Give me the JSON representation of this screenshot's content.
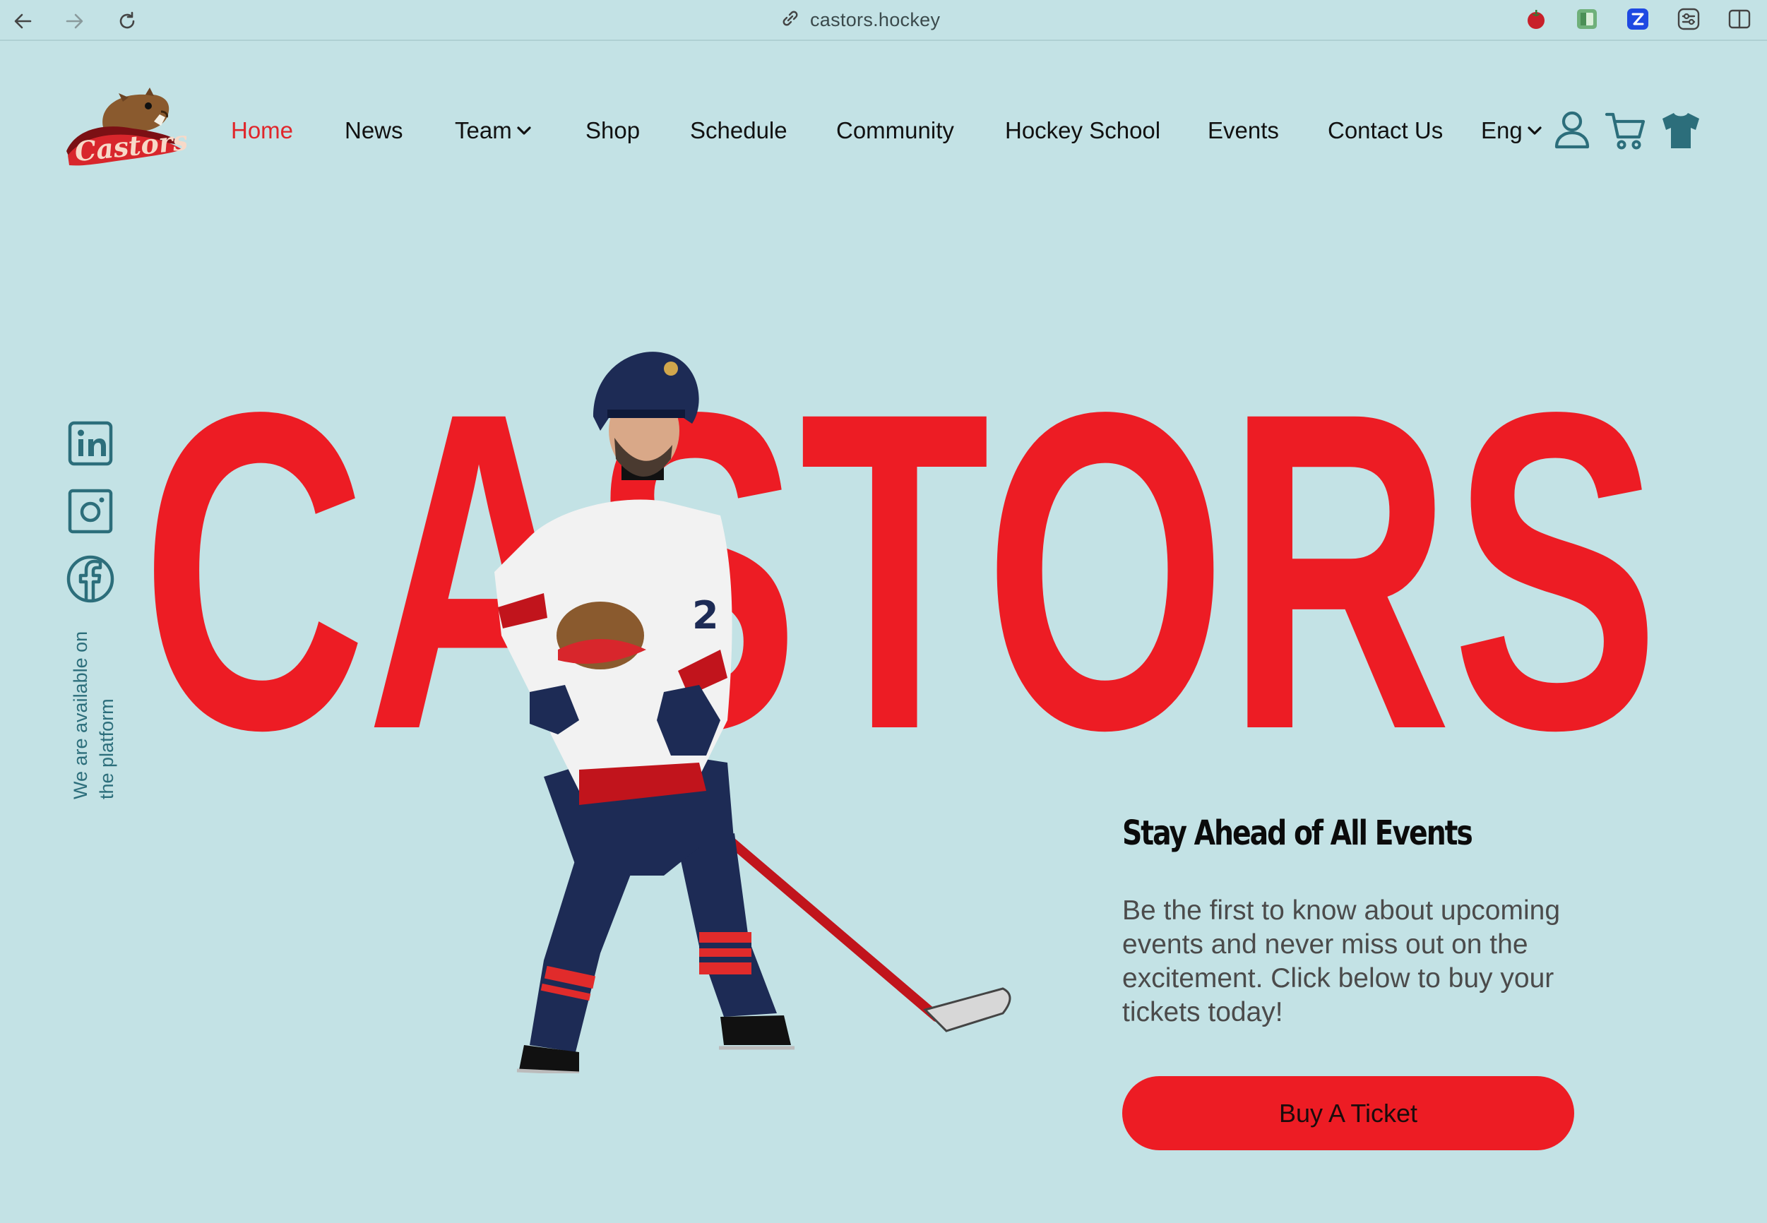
{
  "browser": {
    "url": "castors.hockey",
    "icons": [
      "back-arrow-icon",
      "forward-arrow-icon",
      "reload-icon",
      "link-icon",
      "tomato-extension-icon",
      "notes-extension-icon",
      "blue-extension-icon",
      "settings-extension-icon",
      "sidebar-toggle-icon"
    ]
  },
  "brand": {
    "logo_text": "Castors",
    "accent_color": "#ed1c24",
    "background_color": "#c3e2e5",
    "icon_color": "#2c6e7b"
  },
  "nav": {
    "home": "Home",
    "news": "News",
    "team": "Team",
    "shop": "Shop",
    "schedule": "Schedule",
    "community": "Community",
    "hockey_school": "Hockey School",
    "events": "Events",
    "contact": "Contact Us",
    "language": "Eng",
    "active_item": "Home"
  },
  "header_icons": [
    "user-icon",
    "cart-icon",
    "jersey-icon"
  ],
  "hero": {
    "headline": "CASTORS",
    "social_icons": [
      "linkedin-icon",
      "instagram-icon",
      "facebook-icon"
    ],
    "social_note": "We are available on the platform",
    "player_jersey_number": "2"
  },
  "promo": {
    "title": "Stay Ahead of All Events",
    "text": "Be the first to know about upcoming events and never miss out on the excitement. Click below to buy your tickets today!",
    "button": "Buy A Ticket"
  }
}
